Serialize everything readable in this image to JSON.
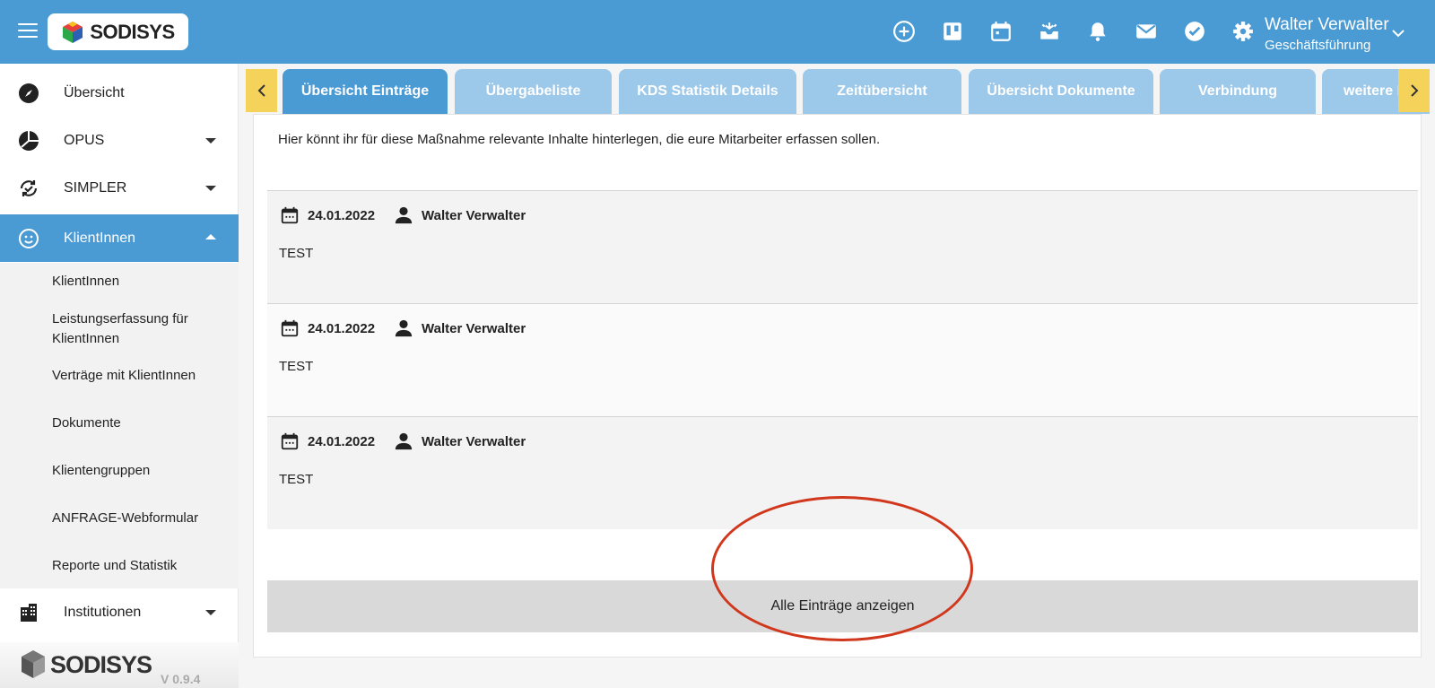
{
  "header": {
    "logo_text": "SODISYS",
    "user_name": "Walter Verwalter",
    "user_role": "Geschäftsführung",
    "icons": [
      "add-circle-icon",
      "board-icon",
      "calendar-icon",
      "inbox-icon",
      "bell-icon",
      "mail-icon",
      "check-circle-icon",
      "gear-icon"
    ]
  },
  "sidebar": {
    "items": [
      {
        "label": "Übersicht",
        "icon": "compass-icon"
      },
      {
        "label": "OPUS",
        "icon": "pie-icon"
      },
      {
        "label": "SIMPLER",
        "icon": "sync-icon"
      },
      {
        "label": "KlientInnen",
        "icon": "smile-icon"
      },
      {
        "label": "Institutionen",
        "icon": "building-icon"
      }
    ],
    "submenu": [
      "KlientInnen",
      "Leistungserfassung für KlientInnen",
      "Verträge mit KlientInnen",
      "Dokumente",
      "Klientengruppen",
      "ANFRAGE-Webformular",
      "Reporte und Statistik"
    ],
    "footer_logo_text": "SODISYS",
    "version": "V 0.9.4"
  },
  "tabs": [
    "Übersicht Einträge",
    "Übergabeliste",
    "KDS Statistik Details",
    "Zeitübersicht",
    "Übersicht Dokumente",
    "Verbindung",
    "weitere I"
  ],
  "main": {
    "intro": "Hier könnt ihr für diese Maßnahme relevante Inhalte hinterlegen, die eure Mitarbeiter erfassen sollen.",
    "entries": [
      {
        "date": "24.01.2022",
        "author": "Walter Verwalter",
        "text": "TEST"
      },
      {
        "date": "24.01.2022",
        "author": "Walter Verwalter",
        "text": "TEST"
      },
      {
        "date": "24.01.2022",
        "author": "Walter Verwalter",
        "text": "TEST"
      }
    ],
    "show_all_label": "Alle Einträge anzeigen"
  },
  "colors": {
    "primary": "#4a9ad4",
    "tab_inactive": "#9cc8ea",
    "nav_arrow": "#f5d35a",
    "annotation": "#d0371c"
  }
}
